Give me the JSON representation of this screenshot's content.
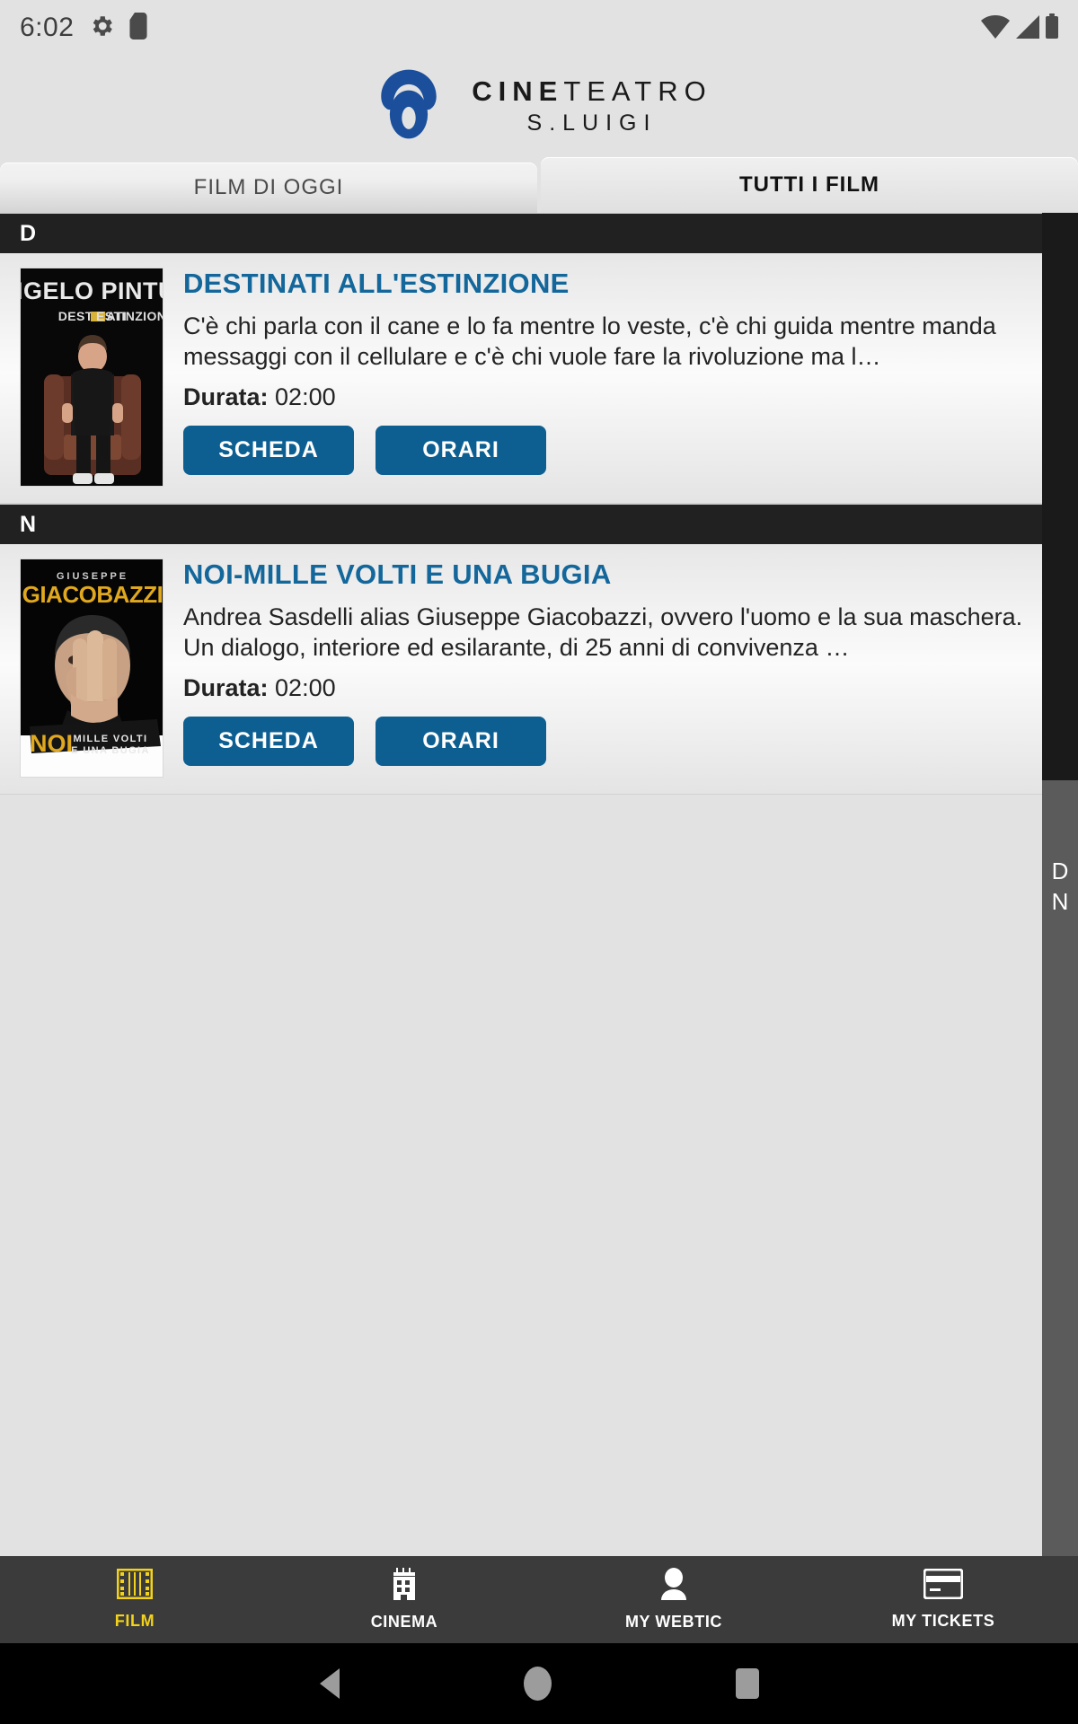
{
  "status_bar": {
    "clock": "6:02",
    "icons": [
      "gear-icon",
      "sd-card-icon",
      "wifi-icon",
      "signal-icon",
      "battery-icon"
    ]
  },
  "header": {
    "logo_icon": "cineteatro-eye-logo",
    "brand_bold": "CINE",
    "brand_thin": "TEATRO",
    "brand_sub": "S.LUIGI",
    "accent_color": "#1b4f9c"
  },
  "tabs": [
    {
      "label": "FILM DI OGGI",
      "active": false
    },
    {
      "label": "TUTTI I FILM",
      "active": true
    }
  ],
  "sections": [
    {
      "letter": "D",
      "movies": [
        {
          "title": "DESTINATI ALL'ESTINZIONE",
          "description": "C'è chi parla con il cane e lo fa mentre lo veste, c'è chi guida mentre manda messaggi con il cellulare e c'è chi vuole fare la rivoluzione ma l…",
          "duration_label": "Durata:",
          "duration_value": "02:00",
          "buttons": [
            "SCHEDA",
            "ORARI"
          ],
          "poster": {
            "top_text": "NGELO PINTU",
            "sub_text": "DESTINATI ALL ESTINZIONE",
            "bg": "#080808",
            "accent": "#d8b33a"
          }
        }
      ]
    },
    {
      "letter": "N",
      "movies": [
        {
          "title": "NOI-MILLE VOLTI E UNA BUGIA",
          "description": "Andrea Sasdelli alias Giuseppe Giacobazzi, ovvero l'uomo e la sua maschera. Un dialogo, interiore ed esilarante, di 25 anni di convivenza …",
          "duration_label": "Durata:",
          "duration_value": "02:00",
          "buttons": [
            "SCHEDA",
            "ORARI"
          ],
          "poster": {
            "top_text": "GIUSEPPE",
            "title_text": "GIACOBAZZI",
            "banner_main": "NOI",
            "banner_line1": "MILLE VOLTI",
            "banner_line2": "E UNA BUGIA",
            "bg": "#050505",
            "accent": "#e0a81e"
          }
        }
      ]
    }
  ],
  "index_strip": {
    "letters": [
      "D",
      "N"
    ],
    "bg_color": "#5b5b5b"
  },
  "bottom_nav": [
    {
      "label": "FILM",
      "icon": "film-strip-icon",
      "active": true
    },
    {
      "label": "CINEMA",
      "icon": "building-icon",
      "active": false
    },
    {
      "label": "MY WEBTIC",
      "icon": "person-icon",
      "active": false
    },
    {
      "label": "MY TICKETS",
      "icon": "card-icon",
      "active": false
    }
  ],
  "system_bar": {
    "back": "back-triangle-icon",
    "home": "home-circle-icon",
    "recents": "recents-square-icon"
  }
}
